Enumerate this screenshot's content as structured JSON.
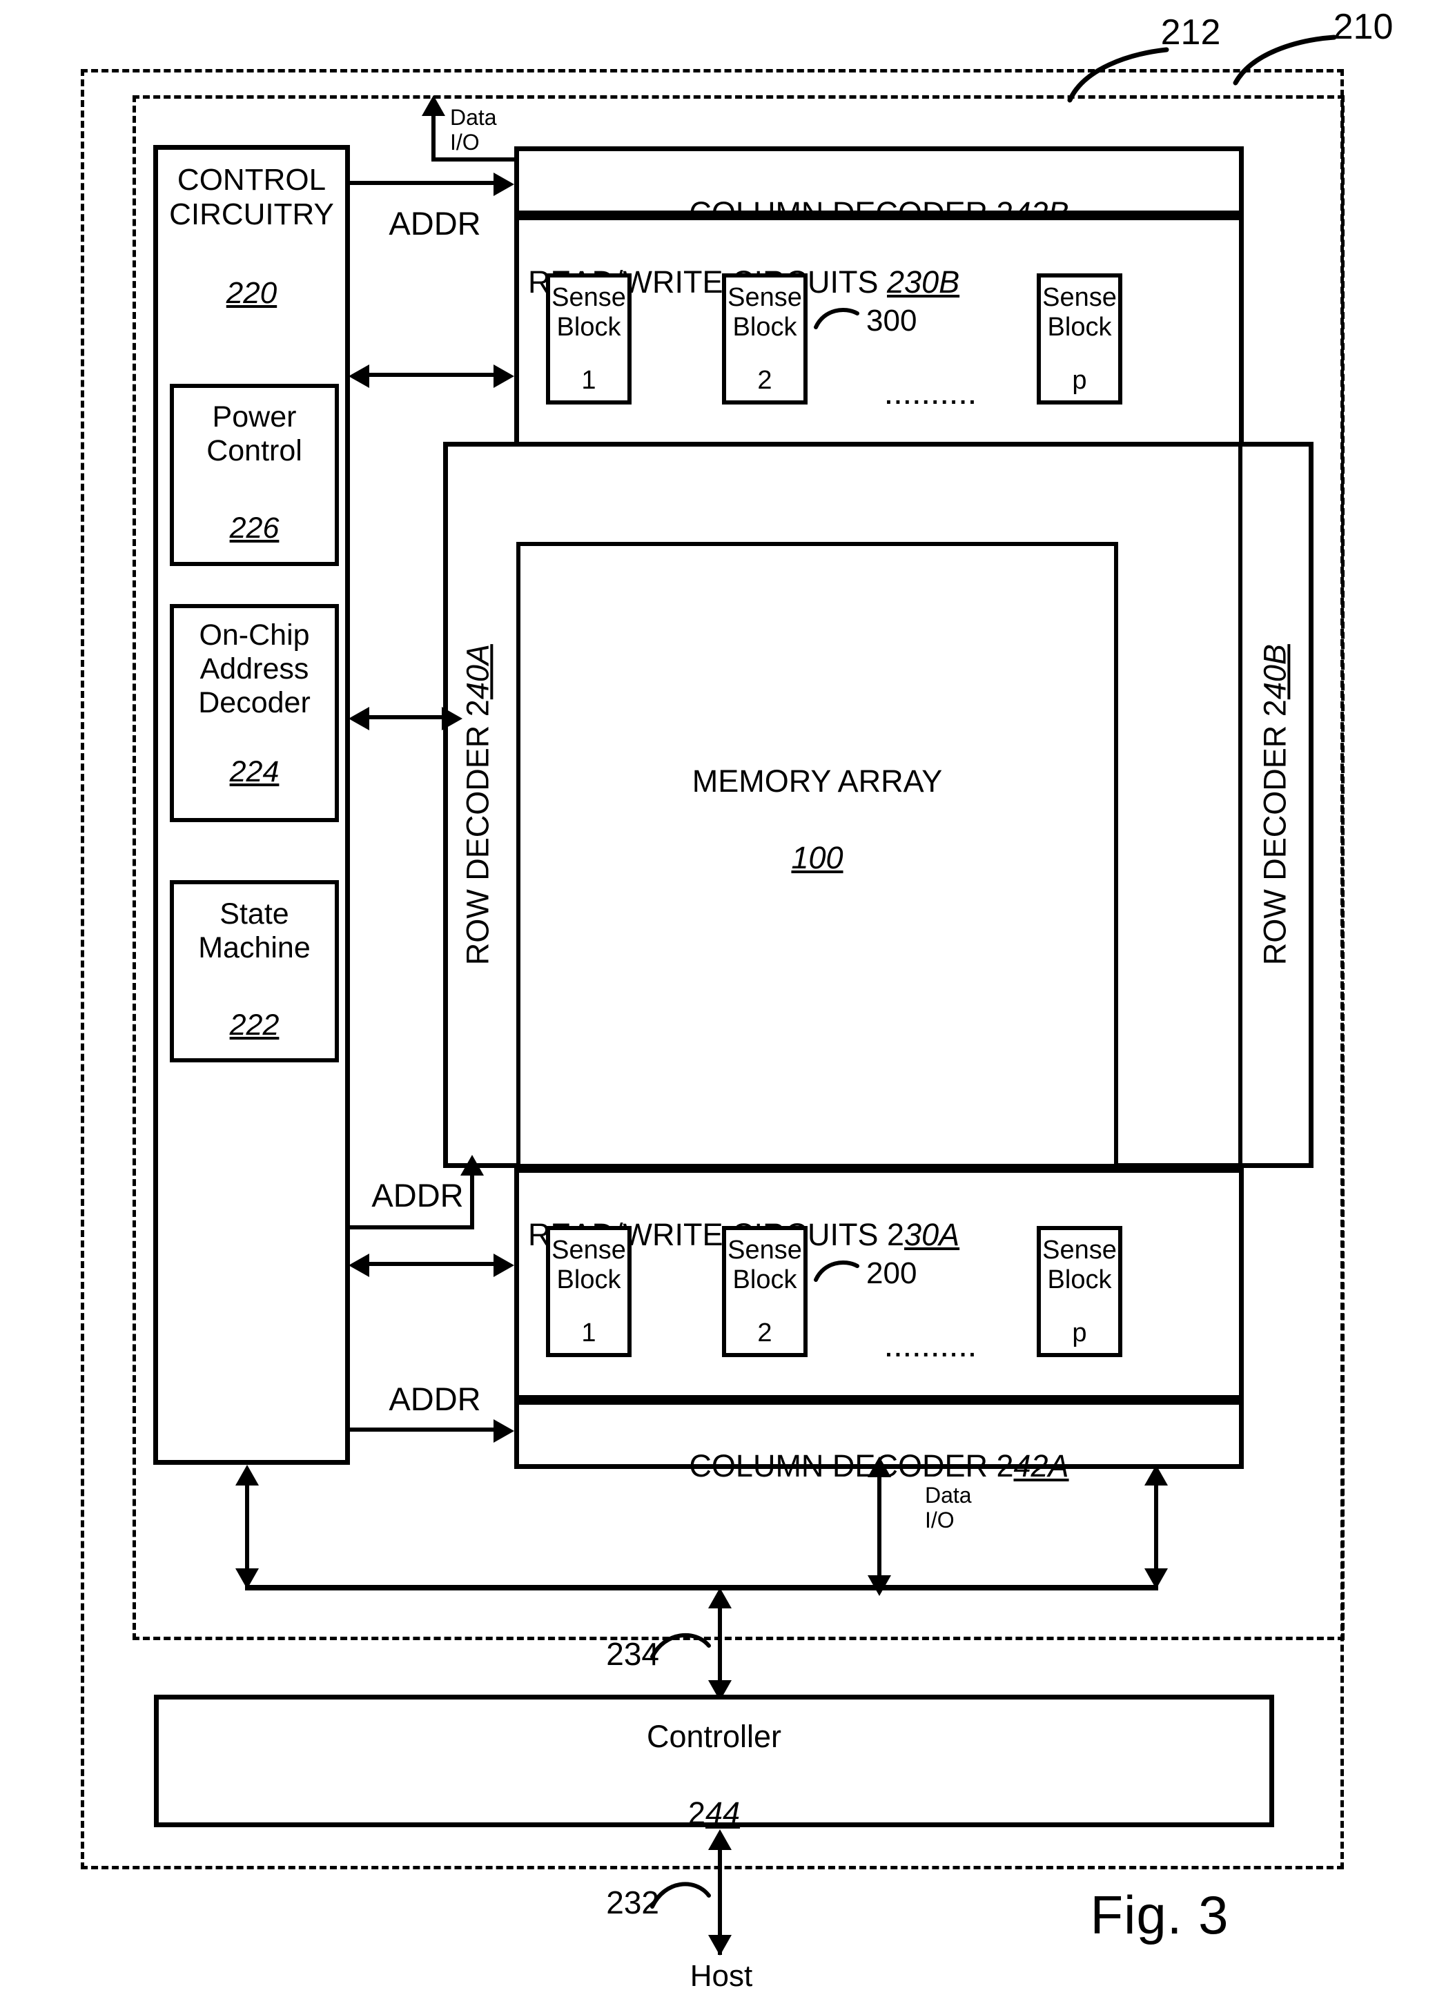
{
  "figure": {
    "caption": "Fig. 3",
    "outer_enclosure_ref": "210",
    "inner_enclosure_ref": "212"
  },
  "control_circuitry": {
    "title": "CONTROL\nCIRCUITRY",
    "ref": "220",
    "blocks": [
      {
        "name": "power_control",
        "title": "Power\nControl",
        "ref": "226"
      },
      {
        "name": "on_chip_address_decoder",
        "title": "On-Chip\nAddress\nDecoder",
        "ref": "224"
      },
      {
        "name": "state_machine",
        "title": "State\nMachine",
        "ref": "222"
      }
    ]
  },
  "column_decoder_b": {
    "label_prefix": "COLUMN DECODER 2",
    "label_ref": "42B"
  },
  "column_decoder_a": {
    "label_prefix": "COLUMN DECODER 2",
    "label_ref": "42A"
  },
  "read_write_b": {
    "label_prefix": "READ/WRITE CIRCUITS ",
    "label_ref": "230B",
    "group_ref": "300",
    "ellipsis": "..........",
    "sense_blocks": [
      {
        "title": "Sense\nBlock",
        "index": "1"
      },
      {
        "title": "Sense\nBlock",
        "index": "2"
      },
      {
        "title": "Sense\nBlock",
        "index": "p"
      }
    ]
  },
  "read_write_a": {
    "label_prefix": "READ/WRITE CIRCUITS 2",
    "label_ref": "30A",
    "group_ref": "200",
    "ellipsis": "..........",
    "sense_blocks": [
      {
        "title": "Sense\nBlock",
        "index": "1"
      },
      {
        "title": "Sense\nBlock",
        "index": "2"
      },
      {
        "title": "Sense\nBlock",
        "index": "p"
      }
    ]
  },
  "row_decoder_a": {
    "label_prefix": "ROW DECODER 2",
    "label_ref": "40A"
  },
  "row_decoder_b": {
    "label_prefix": "ROW DECODER 2",
    "label_ref": "40B"
  },
  "memory_array": {
    "title": "MEMORY ARRAY",
    "ref": "100"
  },
  "controller": {
    "title": "Controller",
    "label_prefix": "2",
    "label_ref": "44",
    "bus_ref": "234"
  },
  "host": {
    "label": "Host",
    "bus_ref": "232"
  },
  "signals": {
    "addr_top": "ADDR",
    "addr_mid": "ADDR",
    "addr_bottom": "ADDR",
    "data_io_top": "Data\nI/O",
    "data_io_bottom": "Data\nI/O"
  }
}
